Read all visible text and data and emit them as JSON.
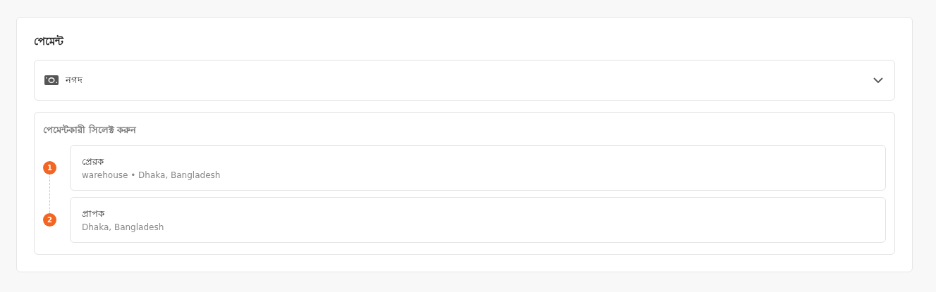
{
  "title": "পেমেন্ট",
  "method": {
    "label": "নগদ",
    "expanded": false
  },
  "payer_section": {
    "heading": "পেমেন্টকারী সিলেক্ট করুন",
    "steps": [
      {
        "number": "1",
        "name": "প্রেরক",
        "detail": "warehouse • Dhaka, Bangladesh"
      },
      {
        "number": "2",
        "name": "প্রাপক",
        "detail": "Dhaka, Bangladesh"
      }
    ]
  }
}
